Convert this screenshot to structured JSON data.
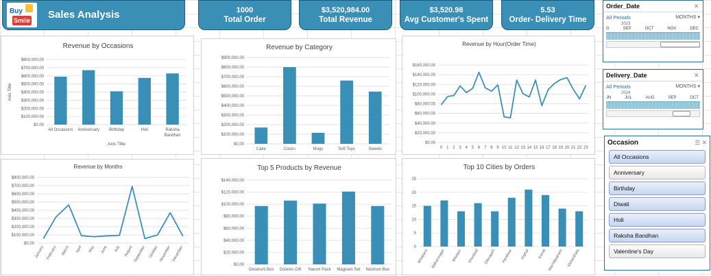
{
  "app": {
    "title": "Sales Analysis",
    "logo_top": "Buy",
    "logo_bottom": "Smile"
  },
  "kpis": [
    {
      "value": "1000",
      "label": "Total Order"
    },
    {
      "value": "$3,520,984.00",
      "label": "Total Revenue"
    },
    {
      "value": "$3,520.98",
      "label": "Avg Customer's Spent"
    },
    {
      "value": "5.53",
      "label": "Order- Delivery Time"
    }
  ],
  "slicers": {
    "order_date": {
      "title": "Order_Date",
      "periods": "All Periods",
      "level": "MONTHS",
      "year": "2023",
      "months": [
        "G",
        "SEP",
        "OCT",
        "NOV",
        "DEC"
      ]
    },
    "delivery_date": {
      "title": "Delivery_Date",
      "periods": "All Periods",
      "level": "MONTHS",
      "year": "2024",
      "months": [
        "JN",
        "JUL",
        "AUG",
        "SEP",
        "OCT"
      ]
    },
    "occasion": {
      "title": "Occasion",
      "items": [
        "All Occasions",
        "Anniversary",
        "Birthday",
        "Diwali",
        "Holi",
        "Raksha Bandhan",
        "Valentine's Day"
      ],
      "selected": [
        true,
        false,
        true,
        true,
        true,
        true,
        false
      ]
    }
  },
  "chart_data": [
    {
      "id": "occasions",
      "type": "bar",
      "title": "Revenue by Occasions",
      "xlabel": "Axis Title",
      "ylabel": "Axis Title",
      "categories": [
        "All Occasions",
        "Anniversary",
        "Birthday",
        "Holi",
        "Raksha Bandhan"
      ],
      "values": [
        590000,
        670000,
        410000,
        575000,
        630000
      ],
      "ylim": [
        0,
        800000
      ],
      "ystep": 100000,
      "yticks": [
        "$0.00",
        "$100,000.00",
        "$200,000.00",
        "$300,000.00",
        "$400,000.00",
        "$500,000.00",
        "$600,000.00",
        "$700,000.00",
        "$800,000.00"
      ],
      "color": "#3a8fb7"
    },
    {
      "id": "category",
      "type": "bar",
      "title": "Revenue by Category",
      "xlabel": "",
      "ylabel": "",
      "categories": [
        "Cake",
        "Colors",
        "Mugs",
        "Soft Toys",
        "Sweets"
      ],
      "values": [
        170000,
        800000,
        115000,
        660000,
        545000
      ],
      "ylim": [
        0,
        900000
      ],
      "ystep": 100000,
      "yticks": [
        "$0.00",
        "$100,000.00",
        "$200,000.00",
        "$300,000.00",
        "$400,000.00",
        "$500,000.00",
        "$600,000.00",
        "$700,000.00",
        "$800,000.00",
        "$900,000.00"
      ],
      "color": "#3a8fb7"
    },
    {
      "id": "hour",
      "type": "line",
      "title": "Revenue by Hour(Order Time)",
      "xlabel": "",
      "ylabel": "",
      "categories": [
        "0",
        "1",
        "2",
        "3",
        "4",
        "5",
        "6",
        "7",
        "8",
        "9",
        "10",
        "11",
        "12",
        "13",
        "14",
        "15",
        "16",
        "17",
        "18",
        "19",
        "20",
        "21",
        "22",
        "23"
      ],
      "values": [
        78000,
        95000,
        97000,
        117000,
        103000,
        112000,
        145000,
        113000,
        106000,
        119000,
        53000,
        51000,
        129000,
        101000,
        94000,
        129000,
        76000,
        109000,
        122000,
        130000,
        134000,
        110000,
        90000,
        118000
      ],
      "ylim": [
        0,
        160000
      ],
      "ystep": 20000,
      "yticks": [
        "$0.00",
        "$20,000.00",
        "$40,000.00",
        "$60,000.00",
        "$80,000.00",
        "$100,000.00",
        "$120,000.00",
        "$140,000.00",
        "$160,000.00"
      ],
      "color": "#3a8fb7"
    },
    {
      "id": "months",
      "type": "line",
      "title": "Revenue by Months",
      "xlabel": "",
      "ylabel": "",
      "categories": [
        "January",
        "February",
        "March",
        "April",
        "May",
        "June",
        "July",
        "August",
        "September",
        "October",
        "November",
        "December"
      ],
      "values": [
        55000,
        320000,
        465000,
        90000,
        78000,
        88000,
        95000,
        690000,
        55000,
        100000,
        370000,
        85000
      ],
      "ylim": [
        0,
        800000
      ],
      "ystep": 100000,
      "yticks": [
        "$0.00",
        "$100,000.00",
        "$200,000.00",
        "$300,000.00",
        "$400,000.00",
        "$500,000.00",
        "$600,000.00",
        "$700,000.00",
        "$800,000.00"
      ],
      "color": "#3a8fb7"
    },
    {
      "id": "products",
      "type": "bar",
      "title": "Top 5 Products by Revenue",
      "xlabel": "",
      "ylabel": "",
      "categories": [
        "Deserunt Box",
        "Dolores Gift",
        "Harum Pack",
        "Magnam Set",
        "Nostrum Box"
      ],
      "values": [
        97000,
        106000,
        101000,
        121000,
        97000
      ],
      "ylim": [
        0,
        140000
      ],
      "ystep": 20000,
      "yticks": [
        "$0.00",
        "$20,000.00",
        "$40,000.00",
        "$60,000.00",
        "$80,000.00",
        "$100,000.00",
        "$120,000.00",
        "$140,000.00"
      ],
      "color": "#3a8fb7"
    },
    {
      "id": "cities",
      "type": "bar",
      "title": "Top 10 Cities by Orders",
      "xlabel": "",
      "ylabel": "",
      "categories": [
        "Bhatpara",
        "Bidhannagar",
        "Bilaspur",
        "Dhanbad",
        "Dibrugarh",
        "Haridwar",
        "Imphal",
        "Kavali",
        "Machilipatnam",
        "Mahesthala"
      ],
      "values": [
        15,
        17,
        13,
        16,
        13,
        18,
        21,
        19,
        14,
        13
      ],
      "ylim": [
        0,
        25
      ],
      "ystep": 5,
      "yticks": [
        "0",
        "5",
        "10",
        "15",
        "20",
        "25"
      ],
      "color": "#3a8fb7"
    }
  ]
}
